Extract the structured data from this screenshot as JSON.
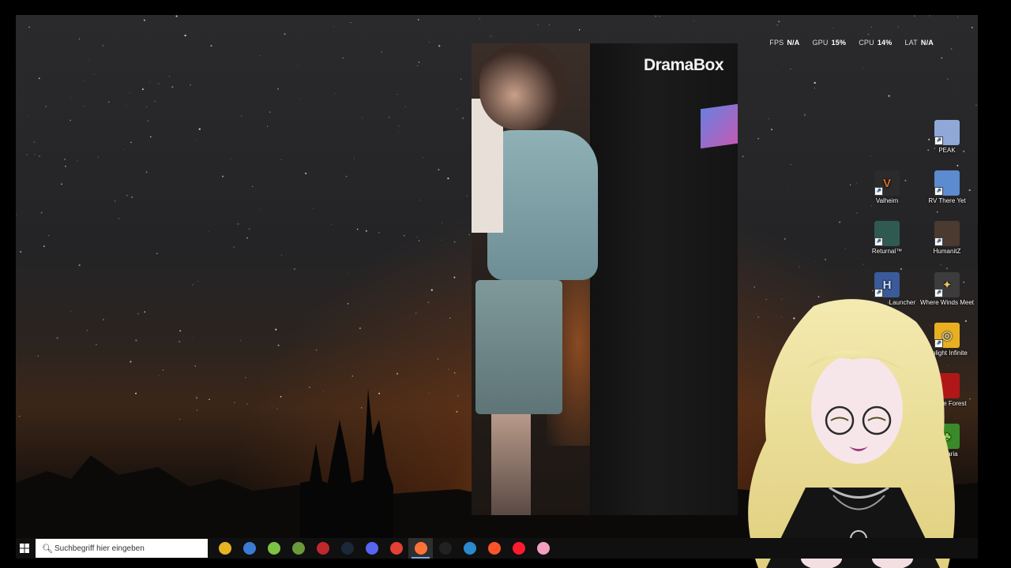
{
  "overlay": {
    "stats": [
      {
        "label": "FPS",
        "value": "N/A"
      },
      {
        "label": "GPU",
        "value": "15%"
      },
      {
        "label": "CPU",
        "value": "14%"
      },
      {
        "label": "LAT",
        "value": "N/A"
      }
    ]
  },
  "video": {
    "logo": "DramaBox"
  },
  "desktop_icons": [
    {
      "label": "PEAK",
      "icon": "peak-icon",
      "color": "#8fa8d8"
    },
    {
      "label": "Valheim",
      "icon": "valheim-icon",
      "color": "#2b2b2b"
    },
    {
      "label": "RV There Yet",
      "icon": "rv-there-yet-icon",
      "color": "#5c8ccf"
    },
    {
      "label": "Returnal™",
      "icon": "returnal-icon",
      "color": "#2f5a52"
    },
    {
      "label": "HumanitZ",
      "icon": "humanitz-icon",
      "color": "#4a3a30"
    },
    {
      "label": "Launcher",
      "icon": "launcher-icon",
      "color": "#3a5a9a"
    },
    {
      "label": "Where Winds Meet",
      "icon": "where-winds-meet-icon",
      "color": "#3c3c3c"
    },
    {
      "label": "rchlight Infinite",
      "icon": "torchlight-infinite-icon",
      "color": "#e8b020"
    },
    {
      "label": "Of The Forest",
      "icon": "sons-of-the-forest-icon",
      "color": "#b01818"
    },
    {
      "label": "Terraria",
      "icon": "terraria-icon",
      "color": "#3a8a2a"
    }
  ],
  "taskbar": {
    "search_placeholder": "Suchbegriff hier eingeben",
    "apps": [
      {
        "name": "file-explorer",
        "color": "#e6b422",
        "active": false
      },
      {
        "name": "microsoft-store",
        "color": "#3a7bd5",
        "active": false
      },
      {
        "name": "android-app",
        "color": "#7cc244",
        "active": false
      },
      {
        "name": "minecraft",
        "color": "#6a9a3a",
        "active": false
      },
      {
        "name": "game-launcher-red",
        "color": "#c0282c",
        "active": false
      },
      {
        "name": "steam",
        "color": "#1b2838",
        "active": false
      },
      {
        "name": "discord",
        "color": "#5865f2",
        "active": false
      },
      {
        "name": "chrome",
        "color": "#e34133",
        "active": false
      },
      {
        "name": "firefox",
        "color": "#ff7139",
        "active": true
      },
      {
        "name": "speedtest",
        "color": "#222222",
        "active": false
      },
      {
        "name": "sync-app",
        "color": "#2a8ad0",
        "active": false
      },
      {
        "name": "brave",
        "color": "#fb542b",
        "active": false
      },
      {
        "name": "opera",
        "color": "#ff1b2d",
        "active": false
      },
      {
        "name": "photo-app",
        "color": "#f3a0c0",
        "active": false
      }
    ]
  }
}
